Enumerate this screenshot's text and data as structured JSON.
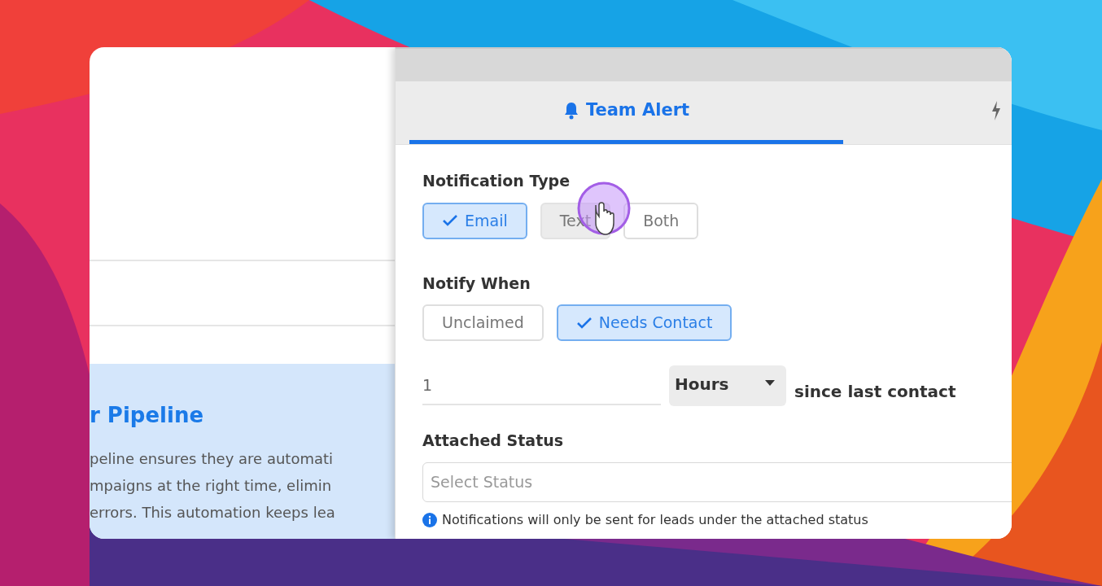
{
  "left_panel": {
    "heading": "r Pipeline",
    "lines": [
      "peline ensures they are automati",
      "mpaigns at the right time, elimin",
      "errors. This automation keeps lea"
    ]
  },
  "tabs": [
    {
      "kind": "labeled",
      "label": "Team Alert",
      "selected": true
    },
    {
      "kind": "icon-only",
      "selected": false
    }
  ],
  "notification_type": {
    "label": "Notification Type",
    "options": [
      {
        "label": "Email",
        "selected": true,
        "hovered": false
      },
      {
        "label": "Text",
        "selected": false,
        "hovered": true
      },
      {
        "label": "Both",
        "selected": false,
        "hovered": false
      }
    ]
  },
  "notify_when": {
    "label": "Notify When",
    "options": [
      {
        "label": "Unclaimed",
        "selected": false,
        "hovered": false
      },
      {
        "label": "Needs Contact",
        "selected": true,
        "hovered": false
      }
    ]
  },
  "duration": {
    "value": "1",
    "unit": "Hours",
    "suffix": "since last contact"
  },
  "attached_status": {
    "label": "Attached Status",
    "placeholder": "Select Status",
    "note": "Notifications will only be sent for leads under the attached status"
  }
}
